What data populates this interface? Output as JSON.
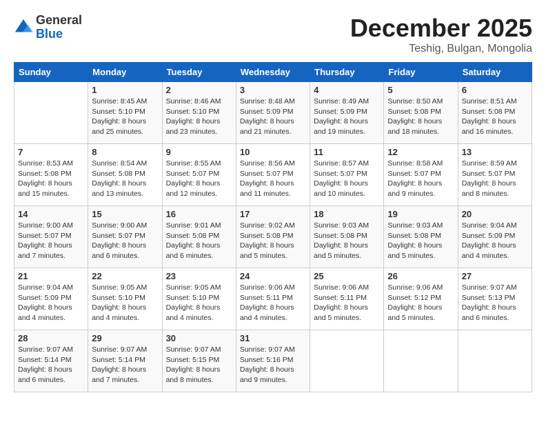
{
  "logo": {
    "general": "General",
    "blue": "Blue"
  },
  "title": "December 2025",
  "subtitle": "Teshig, Bulgan, Mongolia",
  "days_of_week": [
    "Sunday",
    "Monday",
    "Tuesday",
    "Wednesday",
    "Thursday",
    "Friday",
    "Saturday"
  ],
  "weeks": [
    [
      {
        "day": "",
        "sunrise": "",
        "sunset": "",
        "daylight": ""
      },
      {
        "day": "1",
        "sunrise": "Sunrise: 8:45 AM",
        "sunset": "Sunset: 5:10 PM",
        "daylight": "Daylight: 8 hours and 25 minutes."
      },
      {
        "day": "2",
        "sunrise": "Sunrise: 8:46 AM",
        "sunset": "Sunset: 5:10 PM",
        "daylight": "Daylight: 8 hours and 23 minutes."
      },
      {
        "day": "3",
        "sunrise": "Sunrise: 8:48 AM",
        "sunset": "Sunset: 5:09 PM",
        "daylight": "Daylight: 8 hours and 21 minutes."
      },
      {
        "day": "4",
        "sunrise": "Sunrise: 8:49 AM",
        "sunset": "Sunset: 5:09 PM",
        "daylight": "Daylight: 8 hours and 19 minutes."
      },
      {
        "day": "5",
        "sunrise": "Sunrise: 8:50 AM",
        "sunset": "Sunset: 5:08 PM",
        "daylight": "Daylight: 8 hours and 18 minutes."
      },
      {
        "day": "6",
        "sunrise": "Sunrise: 8:51 AM",
        "sunset": "Sunset: 5:08 PM",
        "daylight": "Daylight: 8 hours and 16 minutes."
      }
    ],
    [
      {
        "day": "7",
        "sunrise": "Sunrise: 8:53 AM",
        "sunset": "Sunset: 5:08 PM",
        "daylight": "Daylight: 8 hours and 15 minutes."
      },
      {
        "day": "8",
        "sunrise": "Sunrise: 8:54 AM",
        "sunset": "Sunset: 5:08 PM",
        "daylight": "Daylight: 8 hours and 13 minutes."
      },
      {
        "day": "9",
        "sunrise": "Sunrise: 8:55 AM",
        "sunset": "Sunset: 5:07 PM",
        "daylight": "Daylight: 8 hours and 12 minutes."
      },
      {
        "day": "10",
        "sunrise": "Sunrise: 8:56 AM",
        "sunset": "Sunset: 5:07 PM",
        "daylight": "Daylight: 8 hours and 11 minutes."
      },
      {
        "day": "11",
        "sunrise": "Sunrise: 8:57 AM",
        "sunset": "Sunset: 5:07 PM",
        "daylight": "Daylight: 8 hours and 10 minutes."
      },
      {
        "day": "12",
        "sunrise": "Sunrise: 8:58 AM",
        "sunset": "Sunset: 5:07 PM",
        "daylight": "Daylight: 8 hours and 9 minutes."
      },
      {
        "day": "13",
        "sunrise": "Sunrise: 8:59 AM",
        "sunset": "Sunset: 5:07 PM",
        "daylight": "Daylight: 8 hours and 8 minutes."
      }
    ],
    [
      {
        "day": "14",
        "sunrise": "Sunrise: 9:00 AM",
        "sunset": "Sunset: 5:07 PM",
        "daylight": "Daylight: 8 hours and 7 minutes."
      },
      {
        "day": "15",
        "sunrise": "Sunrise: 9:00 AM",
        "sunset": "Sunset: 5:07 PM",
        "daylight": "Daylight: 8 hours and 6 minutes."
      },
      {
        "day": "16",
        "sunrise": "Sunrise: 9:01 AM",
        "sunset": "Sunset: 5:08 PM",
        "daylight": "Daylight: 8 hours and 6 minutes."
      },
      {
        "day": "17",
        "sunrise": "Sunrise: 9:02 AM",
        "sunset": "Sunset: 5:08 PM",
        "daylight": "Daylight: 8 hours and 5 minutes."
      },
      {
        "day": "18",
        "sunrise": "Sunrise: 9:03 AM",
        "sunset": "Sunset: 5:08 PM",
        "daylight": "Daylight: 8 hours and 5 minutes."
      },
      {
        "day": "19",
        "sunrise": "Sunrise: 9:03 AM",
        "sunset": "Sunset: 5:08 PM",
        "daylight": "Daylight: 8 hours and 5 minutes."
      },
      {
        "day": "20",
        "sunrise": "Sunrise: 9:04 AM",
        "sunset": "Sunset: 5:09 PM",
        "daylight": "Daylight: 8 hours and 4 minutes."
      }
    ],
    [
      {
        "day": "21",
        "sunrise": "Sunrise: 9:04 AM",
        "sunset": "Sunset: 5:09 PM",
        "daylight": "Daylight: 8 hours and 4 minutes."
      },
      {
        "day": "22",
        "sunrise": "Sunrise: 9:05 AM",
        "sunset": "Sunset: 5:10 PM",
        "daylight": "Daylight: 8 hours and 4 minutes."
      },
      {
        "day": "23",
        "sunrise": "Sunrise: 9:05 AM",
        "sunset": "Sunset: 5:10 PM",
        "daylight": "Daylight: 8 hours and 4 minutes."
      },
      {
        "day": "24",
        "sunrise": "Sunrise: 9:06 AM",
        "sunset": "Sunset: 5:11 PM",
        "daylight": "Daylight: 8 hours and 4 minutes."
      },
      {
        "day": "25",
        "sunrise": "Sunrise: 9:06 AM",
        "sunset": "Sunset: 5:11 PM",
        "daylight": "Daylight: 8 hours and 5 minutes."
      },
      {
        "day": "26",
        "sunrise": "Sunrise: 9:06 AM",
        "sunset": "Sunset: 5:12 PM",
        "daylight": "Daylight: 8 hours and 5 minutes."
      },
      {
        "day": "27",
        "sunrise": "Sunrise: 9:07 AM",
        "sunset": "Sunset: 5:13 PM",
        "daylight": "Daylight: 8 hours and 6 minutes."
      }
    ],
    [
      {
        "day": "28",
        "sunrise": "Sunrise: 9:07 AM",
        "sunset": "Sunset: 5:14 PM",
        "daylight": "Daylight: 8 hours and 6 minutes."
      },
      {
        "day": "29",
        "sunrise": "Sunrise: 9:07 AM",
        "sunset": "Sunset: 5:14 PM",
        "daylight": "Daylight: 8 hours and 7 minutes."
      },
      {
        "day": "30",
        "sunrise": "Sunrise: 9:07 AM",
        "sunset": "Sunset: 5:15 PM",
        "daylight": "Daylight: 8 hours and 8 minutes."
      },
      {
        "day": "31",
        "sunrise": "Sunrise: 9:07 AM",
        "sunset": "Sunset: 5:16 PM",
        "daylight": "Daylight: 8 hours and 9 minutes."
      },
      {
        "day": "",
        "sunrise": "",
        "sunset": "",
        "daylight": ""
      },
      {
        "day": "",
        "sunrise": "",
        "sunset": "",
        "daylight": ""
      },
      {
        "day": "",
        "sunrise": "",
        "sunset": "",
        "daylight": ""
      }
    ]
  ]
}
